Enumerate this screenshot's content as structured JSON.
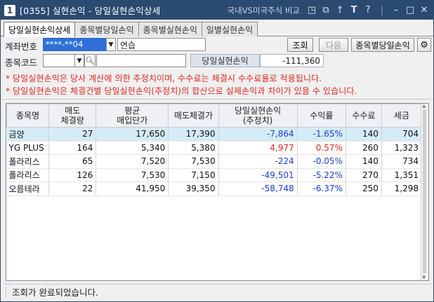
{
  "window": {
    "number": "1",
    "title": "[0355] 실현손익 - 당일실현손익상세",
    "compare_link": "국내VS미국주식 비교",
    "icons": [
      "layout-icon",
      "copy-window-icon",
      "pin-icon",
      "font-size-icon",
      "help-icon",
      "minimize-icon",
      "maximize-icon",
      "close-icon"
    ]
  },
  "tabs": [
    {
      "label": "당일실현손익상세",
      "active": true
    },
    {
      "label": "종목별당일손익",
      "active": false
    },
    {
      "label": "종목별실현손익",
      "active": false
    },
    {
      "label": "일별실현손익",
      "active": false
    }
  ],
  "form": {
    "account_label": "계좌번호",
    "account_value": "****-**04",
    "account_name": "연습",
    "query_button": "조회",
    "next_button": "다음",
    "stock_daily_button": "종목별당일손익",
    "stock_code_label": "종목코드",
    "stock_code_value": "",
    "stock_name_value": "",
    "daily_pnl_label": "당일실현손익",
    "daily_pnl_value": "-111,360"
  },
  "notices": [
    "* 당일실현손익은 당사 계산에 의한 추정치이며, 수수료는 체결시 수수료율로 적용됩니다.",
    "* 당일실현손익은 체결건별 당일실현손익(추정치)의 합산으로 실제손익과 차이가 있을 수 있습니다."
  ],
  "table": {
    "headers": [
      [
        "종목명"
      ],
      [
        "매도",
        "체결량"
      ],
      [
        "평균",
        "매입단가"
      ],
      [
        "매도체결가"
      ],
      [
        "당일실현손익",
        "(추정치)"
      ],
      [
        "수익률"
      ],
      [
        "수수료"
      ],
      [
        "세금"
      ]
    ],
    "rows": [
      {
        "name": "금양",
        "qty": "27",
        "avg": "17,650",
        "sell": "17,390",
        "pnl": "-7,864",
        "rate": "-1.65%",
        "fee": "140",
        "tax": "704",
        "sign": "neg",
        "selected": true
      },
      {
        "name": "YG PLUS",
        "qty": "164",
        "avg": "5,340",
        "sell": "5,380",
        "pnl": "4,977",
        "rate": "0.57%",
        "fee": "260",
        "tax": "1,323",
        "sign": "pos",
        "selected": false
      },
      {
        "name": "폴라리스",
        "qty": "65",
        "avg": "7,520",
        "sell": "7,530",
        "pnl": "-224",
        "rate": "-0.05%",
        "fee": "140",
        "tax": "734",
        "sign": "neg",
        "selected": false
      },
      {
        "name": "폴라리스",
        "qty": "126",
        "avg": "7,530",
        "sell": "7,150",
        "pnl": "-49,501",
        "rate": "-5.22%",
        "fee": "270",
        "tax": "1,351",
        "sign": "neg",
        "selected": false
      },
      {
        "name": "오름테라",
        "qty": "22",
        "avg": "41,950",
        "sell": "39,350",
        "pnl": "-58,748",
        "rate": "-6.37%",
        "fee": "250",
        "tax": "1,298",
        "sign": "neg",
        "selected": false
      }
    ]
  },
  "status": {
    "message": "조회가 완료되었습니다."
  },
  "colors": {
    "title_bar": "#2b4a70",
    "account_highlight": "#2f6fd6",
    "notice_red": "#e0261f",
    "negative_blue": "#1a3fd6",
    "selected_row": "#d5ebf7"
  }
}
